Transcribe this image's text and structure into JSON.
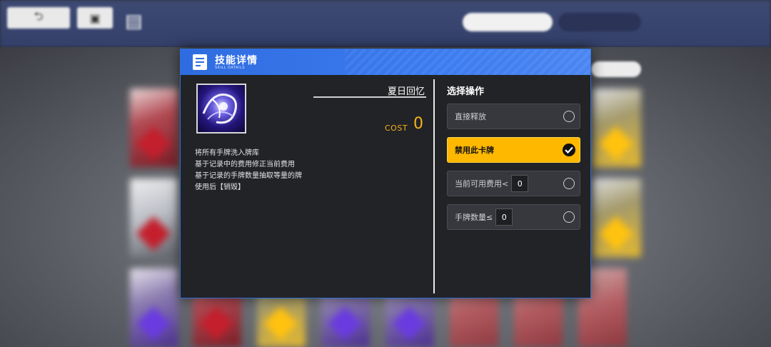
{
  "modal": {
    "title": "技能详情",
    "subtitle": "SKILL DATAILS",
    "skill_name": "夏日回忆",
    "cost_label": "COST",
    "cost_value": "0",
    "description": [
      "将所有手牌洗入牌库",
      "基于记录中的费用修正当前费用",
      "基于记录的手牌数量抽取等量的牌",
      "使用后【销毁】"
    ],
    "ops_title": "选择操作",
    "options": [
      {
        "label": "直接释放",
        "selected": false
      },
      {
        "label": "禁用此卡牌",
        "selected": true
      },
      {
        "label": "当前可用费用<",
        "value": "0",
        "selected": false
      },
      {
        "label": "手牌数量≤",
        "value": "0",
        "selected": false
      }
    ]
  },
  "colors": {
    "accent_blue": "#2f6ce0",
    "selected_yellow": "#ffb800",
    "cost_orange": "#f4b21b"
  }
}
